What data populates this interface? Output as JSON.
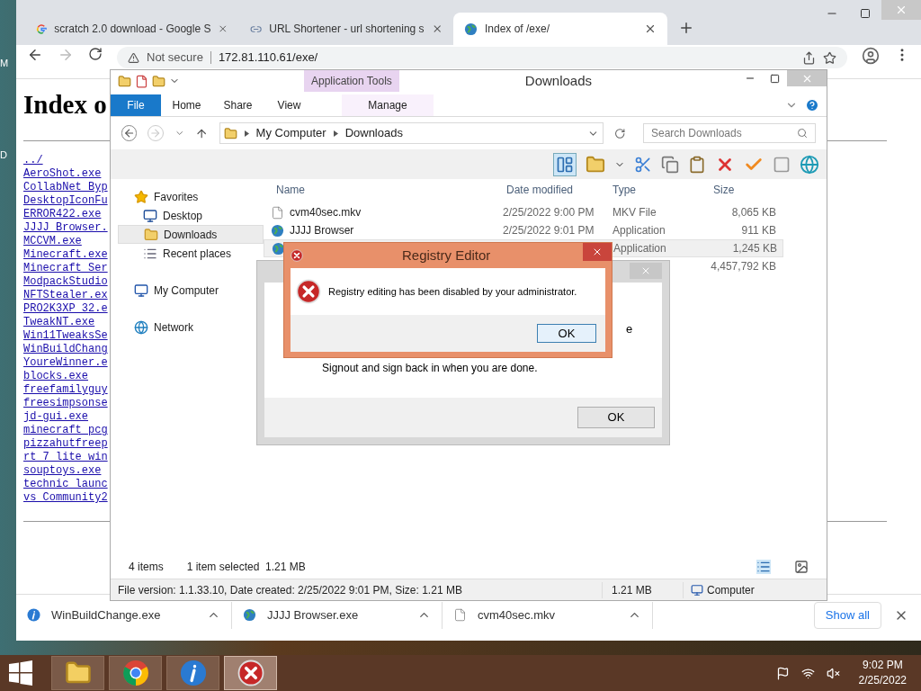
{
  "desktop": {
    "labels": [
      "M",
      "D"
    ]
  },
  "browser": {
    "tabs": [
      {
        "kind": "google",
        "title": "scratch 2.0 download - Google S",
        "selected": false
      },
      {
        "kind": "link",
        "title": "URL Shortener - url shortening s",
        "selected": false
      },
      {
        "kind": "globe",
        "title": "Index of /exe/",
        "selected": true
      }
    ],
    "address": {
      "security": "Not secure",
      "url": "172.81.110.61/exe/"
    },
    "page": {
      "heading": "Index o",
      "links": [
        "../",
        "AeroShot.exe",
        "CollabNet_Byp",
        "DesktopIconFu",
        "ERROR422.exe",
        "JJJJ_Browser.",
        "MCCVM.exe",
        "Minecraft.exe",
        "Minecraft_Ser",
        "ModpackStudio",
        "NFTStealer.ex",
        "PRO2K3XP_32.e",
        "TweakNT.exe",
        "Win11TweaksSe",
        "WinBuildChang",
        "YoureWinner.e",
        "blocks.exe",
        "freefamilyguy",
        "freesimpsonse",
        "jd-gui.exe",
        "minecraft_pcg",
        "pizzahutfreep",
        "rt_7_lite_win",
        "souptoys.exe",
        "technic_launc",
        "vs_Community2"
      ]
    },
    "downloads": [
      {
        "kind": "info",
        "name": "WinBuildChange.exe"
      },
      {
        "kind": "globe",
        "name": "JJJJ Browser.exe"
      },
      {
        "kind": "file",
        "name": "cvm40sec.mkv"
      }
    ],
    "show_all": "Show all"
  },
  "explorer": {
    "title": "Downloads",
    "context_tab": "Application Tools",
    "ribbon_tabs": [
      {
        "label": "File",
        "kind": "file",
        "selected": false
      },
      {
        "label": "Home",
        "kind": "tab",
        "selected": false
      },
      {
        "label": "Share",
        "kind": "tab",
        "selected": false
      },
      {
        "label": "View",
        "kind": "tab",
        "selected": false
      },
      {
        "label": "Manage",
        "kind": "context",
        "selected": false
      }
    ],
    "path": [
      "My Computer",
      "Downloads"
    ],
    "search": {
      "placeholder": "Search Downloads"
    },
    "nav": [
      {
        "kind": "favorites",
        "label": "Favorites",
        "selected": false,
        "children": [
          {
            "kind": "desktop",
            "label": "Desktop",
            "selected": false
          },
          {
            "kind": "downloads",
            "label": "Downloads",
            "selected": true
          },
          {
            "kind": "recent",
            "label": "Recent places",
            "selected": false
          }
        ]
      },
      {
        "kind": "computer",
        "label": "My Computer",
        "selected": false
      },
      {
        "kind": "network",
        "label": "Network",
        "selected": false
      }
    ],
    "columns": [
      "Name",
      "Date modified",
      "Type",
      "Size"
    ],
    "files": [
      {
        "kind": "file",
        "name": "cvm40sec.mkv",
        "date": "2/25/2022 9:00 PM",
        "type": "MKV File",
        "size": "8,065 KB",
        "selected": false
      },
      {
        "kind": "globe",
        "name": "JJJJ Browser",
        "date": "2/25/2022 9:01 PM",
        "type": "Application",
        "size": "911 KB",
        "selected": false
      },
      {
        "kind": "globe",
        "type": "Application",
        "size": "1,245 KB",
        "selected": true
      },
      {
        "kind": "none",
        "size": "4,457,792 KB",
        "selected": false
      }
    ],
    "status": {
      "count": "4 items",
      "selection": "1 item selected  1.21 MB"
    },
    "details": {
      "info": "File version: 1.1.33.10, Date created: 2/25/2022 9:01 PM, Size: 1.21 MB",
      "size": "1.21 MB",
      "zone": "Computer"
    }
  },
  "back_dialog": {
    "fragment": "e",
    "message": "Signout and sign back in when you are done.",
    "button": "OK"
  },
  "error_dialog": {
    "title": "Registry Editor",
    "message": "Registry editing has been disabled by your administrator.",
    "button": "OK"
  },
  "taskbar": {
    "apps": [
      {
        "kind": "explorer",
        "selected": false
      },
      {
        "kind": "chrome",
        "selected": false
      },
      {
        "kind": "info",
        "selected": false
      },
      {
        "kind": "error",
        "selected": true
      }
    ],
    "time": "9:02 PM",
    "date": "2/25/2022"
  }
}
